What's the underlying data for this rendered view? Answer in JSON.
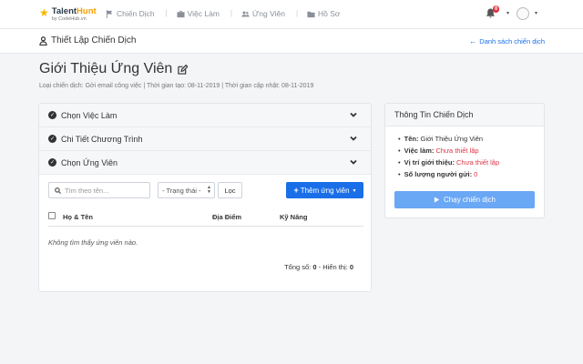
{
  "nav": {
    "brand_talent": "Talent",
    "brand_hunt": "Hunt",
    "brand_sub": "by CodeHub.vn",
    "items": [
      {
        "label": "Chiến Dịch",
        "icon": "flag-icon"
      },
      {
        "label": "Việc Làm",
        "icon": "briefcase-icon"
      },
      {
        "label": "Ứng Viên",
        "icon": "users-icon"
      },
      {
        "label": "Hồ Sơ",
        "icon": "folder-icon"
      }
    ],
    "notification_count": "0"
  },
  "subheader": {
    "title": "Thiết Lập Chiến Dịch",
    "back_link": "Danh sách chiến dịch"
  },
  "page": {
    "title": "Giới Thiệu Ứng Viên",
    "meta": "Loại chiến dịch: Gởi email công việc | Thời gian tạo: 08-11-2019 | Thời gian cập nhật: 08-11-2019"
  },
  "accordion": [
    {
      "label": "Chọn Việc Làm"
    },
    {
      "label": "Chi Tiết Chương Trình"
    },
    {
      "label": "Chọn Ứng Viên"
    }
  ],
  "toolbar": {
    "search_placeholder": "Tìm theo tên...",
    "status_selected": "- Trạng thái -",
    "filter_label": "Lọc",
    "add_label": "Thêm ứng viên"
  },
  "table": {
    "columns": [
      "Họ & Tên",
      "Địa Điểm",
      "Kỹ Năng"
    ],
    "empty_message": "Không tìm thấy ứng viên nào.",
    "total_label": "Tổng số:",
    "total_value": "0",
    "shown_label": "- Hiển thị:",
    "shown_value": "0"
  },
  "info": {
    "title": "Thông Tin Chiến Dịch",
    "name_label": "Tên:",
    "name_value": "Giới Thiệu Ứng Viên",
    "job_label": "Việc làm:",
    "job_value": "Chưa thiết lập",
    "position_label": "Vị trí giới thiệu:",
    "position_value": "Chưa thiết lập",
    "sent_label": "Số lượng người gửi:",
    "sent_value": "0",
    "run_button": "Chạy chiến dịch"
  },
  "colors": {
    "primary": "#1a6fe8",
    "danger": "#dc3545",
    "accent": "#f5a000"
  }
}
